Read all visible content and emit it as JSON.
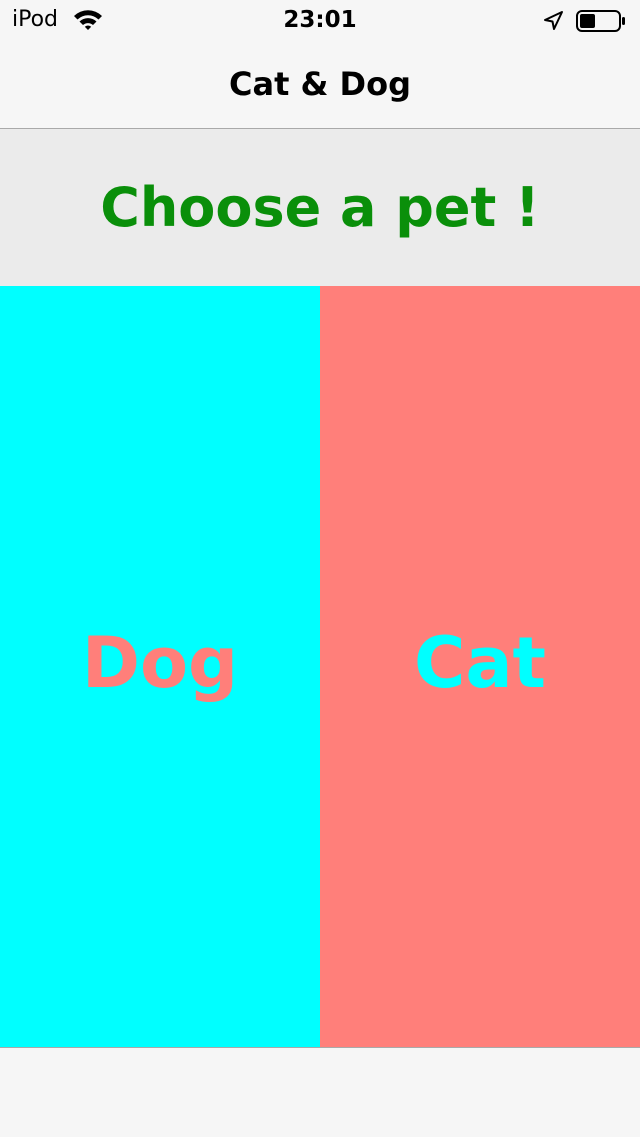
{
  "status_bar": {
    "carrier": "iPod",
    "time": "23:01",
    "wifi_icon": "wifi-icon",
    "location_icon": "location-arrow-icon",
    "battery_icon": "battery-icon",
    "battery_level": 0.4
  },
  "nav": {
    "title": "Cat & Dog"
  },
  "banner": {
    "text": "Choose a pet !",
    "color": "#0a8f0a"
  },
  "pets": {
    "dog": {
      "label": "Dog",
      "bg_color": "#00ffff",
      "text_color": "#ff7f7a"
    },
    "cat": {
      "label": "Cat",
      "bg_color": "#ff7f7a",
      "text_color": "#00ffff"
    }
  },
  "colors": {
    "bar_bg": "#f6f6f6",
    "banner_bg": "#ebebeb",
    "divider": "#a9a9a9"
  }
}
